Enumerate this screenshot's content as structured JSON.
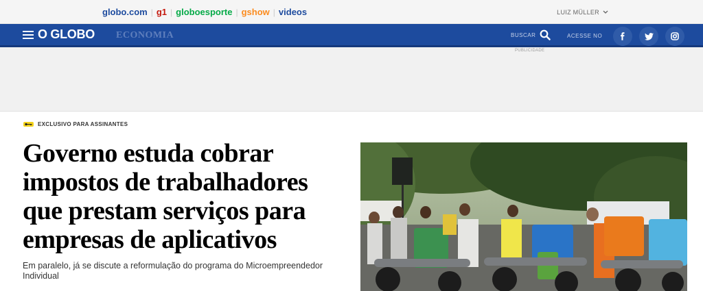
{
  "topbar": {
    "portals": [
      {
        "label": "globo.com",
        "color": "#1d4b9e"
      },
      {
        "label": "g1",
        "color": "#c4170c"
      },
      {
        "label": "globoesporte",
        "color": "#06aa48"
      },
      {
        "label": "gshow",
        "color": "#fb8b1e"
      },
      {
        "label": "videos",
        "color": "#1d4b9e"
      }
    ],
    "user_name": "LUIZ MÜLLER"
  },
  "navbar": {
    "logo": "O GLOBO",
    "section": "ECONOMIA",
    "search_label": "BUSCAR",
    "login_label": "ACESSE NO",
    "social_icons": [
      "facebook-icon",
      "twitter-icon",
      "instagram-icon"
    ],
    "background": "#1d4b9e"
  },
  "ad": {
    "label": "PUBLICIDADE"
  },
  "article": {
    "badge": "EXCLUSIVO PARA ASSINANTES",
    "headline": "Governo estuda cobrar impostos de trabalhadores que prestam serviços para empresas de aplicativos",
    "subhead": "Em paralelo, já se discute a reformulação do programa do Microempreendedor Individual"
  }
}
